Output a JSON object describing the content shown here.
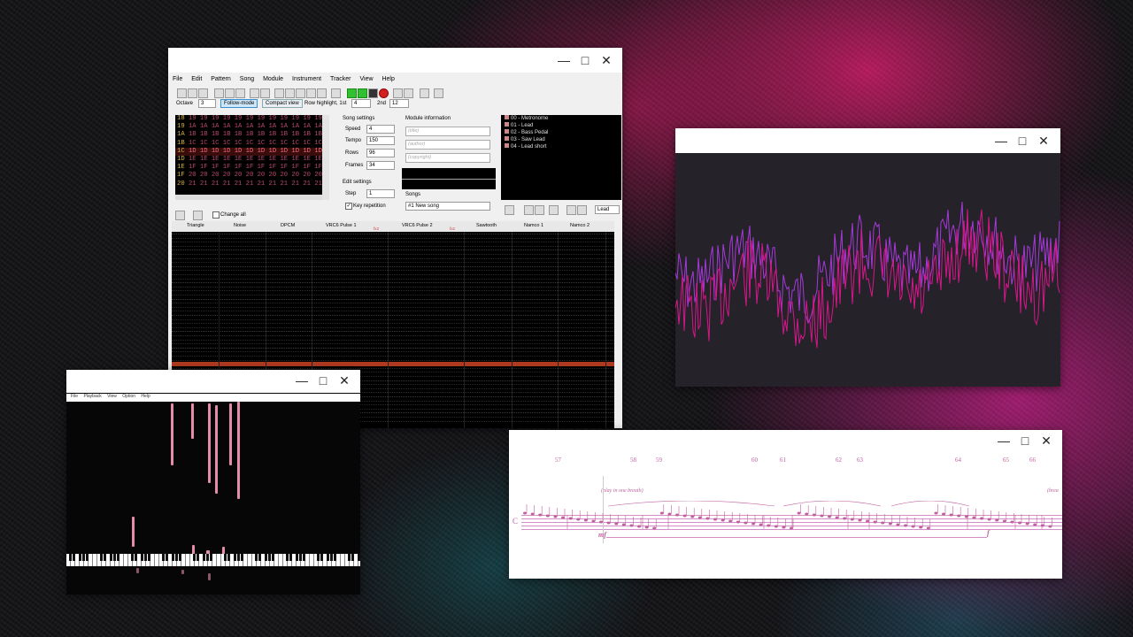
{
  "famitracker": {
    "menu": [
      "File",
      "Edit",
      "Pattern",
      "Song",
      "Module",
      "Instrument",
      "Tracker",
      "View",
      "Help"
    ],
    "octave_label": "Octave",
    "octave_value": "3",
    "follow_mode": "Follow-mode",
    "compact_view": "Compact view",
    "row_highlight_label": "Row highlight, 1st",
    "row_highlight_1st": "4",
    "second_label": "2nd",
    "row_highlight_2nd": "12",
    "frames": [
      {
        "num": "18",
        "cells": "19 19 19 19 19 19 19 19 19 19 19 19 19"
      },
      {
        "num": "19",
        "cells": "1A 1A 1A 1A 1A 1A 1A 1A 1A 1A 1A 1A 1A"
      },
      {
        "num": "1A",
        "cells": "1B 1B 1B 1B 1B 1B 1B 1B 1B 1B 1B 1B 1B"
      },
      {
        "num": "1B",
        "cells": "1C 1C 1C 1C 1C 1C 1C 1C 1C 1C 1C 1C 1C"
      },
      {
        "num": "1C",
        "cells": "1D 1D 1D 1D 1D 1D 1D 1D 1D 1D 1D 1D 1D"
      },
      {
        "num": "1D",
        "cells": "1E 1E 1E 1E 1E 1E 1E 1E 1E 1E 1E 1E 1E"
      },
      {
        "num": "1E",
        "cells": "1F 1F 1F 1F 1F 1F 1F 1F 1F 1F 1F 1F 1F"
      },
      {
        "num": "1F",
        "cells": "20 20 20 20 20 20 20 20 20 20 20 20 20"
      },
      {
        "num": "20",
        "cells": "21 21 21 21 21 21 21 21 21 21 21 21 21"
      }
    ],
    "song_settings": {
      "title": "Song settings",
      "speed_label": "Speed",
      "speed": "4",
      "tempo_label": "Tempo",
      "tempo": "150",
      "rows_label": "Rows",
      "rows": "96",
      "frames_label": "Frames",
      "frames": "34"
    },
    "edit_settings": {
      "title": "Edit settings",
      "step_label": "Step",
      "step": "1",
      "key_repetition": "Key repetition"
    },
    "module_info": {
      "title": "Module information",
      "title_ph": "(title)",
      "author_ph": "(author)",
      "copyright_ph": "(copyright)"
    },
    "songs_label": "Songs",
    "song_selected": "#1 New song",
    "instruments": [
      "00 - Metronome",
      "01 - Lead",
      "02 - Bass Pedal",
      "03 - Saw Lead",
      "04 - Lead short"
    ],
    "instrument_name": "Lead",
    "change_all": "Change all",
    "channels": [
      "Triangle",
      "Noise",
      "DPCM",
      "VRC6 Pulse 1",
      "VRC6 Pulse 2",
      "Sawtooth",
      "Namco 1",
      "Namco 2"
    ],
    "fx_label": "fx2"
  },
  "piano": {
    "menu": [
      "File",
      "Playback",
      "View",
      "Option",
      "Help"
    ]
  },
  "score": {
    "measures": [
      "57",
      "58",
      "59",
      "60",
      "61",
      "62",
      "63",
      "64",
      "65",
      "66"
    ],
    "expression": "(play in one breath)",
    "expression2": "(brea",
    "dynamic_mf": "mf",
    "dynamic_f": "f",
    "instrument_abbr": "C"
  },
  "colors": {
    "osc_magenta": "#d4188a",
    "osc_violet": "#a43ad8",
    "note_pink": "#e58ca8",
    "score_pink": "#c060a0"
  }
}
